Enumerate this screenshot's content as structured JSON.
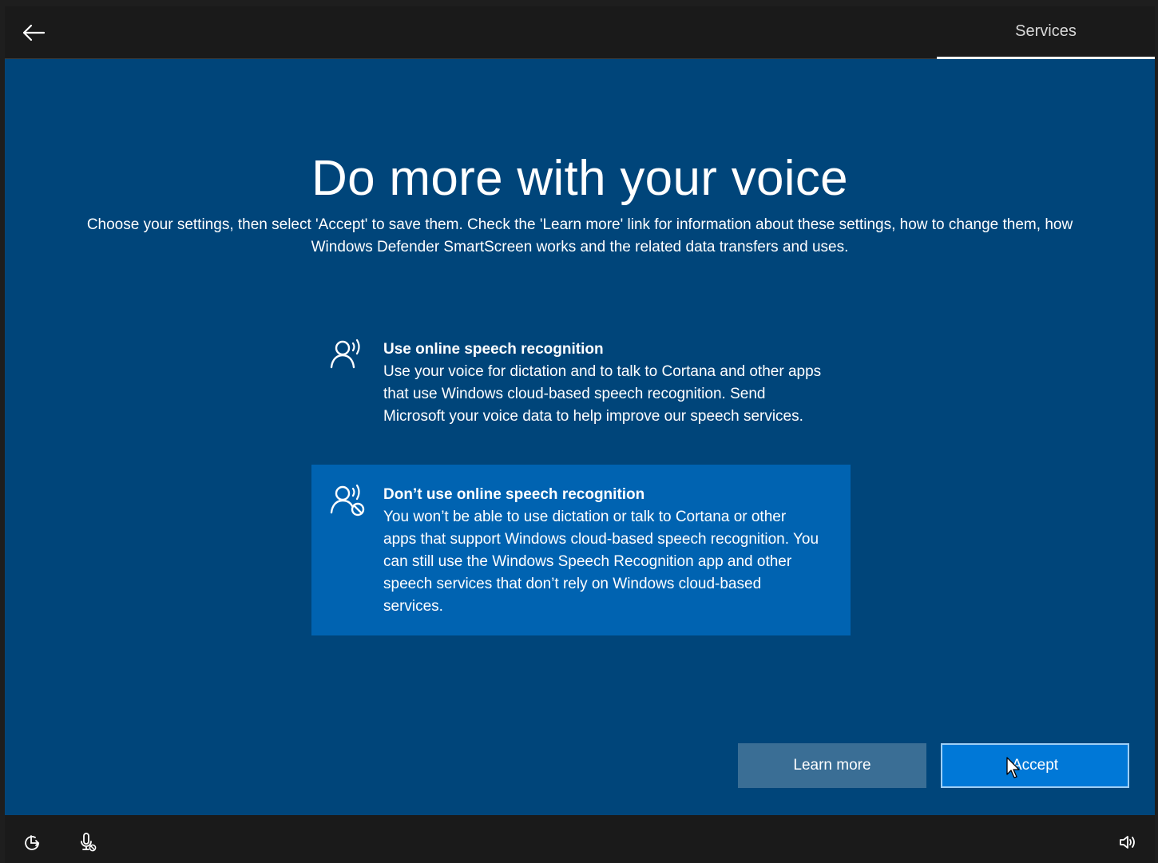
{
  "header": {
    "tab_label": "Services"
  },
  "main": {
    "title": "Do more with your voice",
    "subtitle": "Choose your settings, then select 'Accept' to save them. Check the 'Learn more' link for information about these settings, how to change them, how Windows Defender SmartScreen works and the related data transfers and uses."
  },
  "options": [
    {
      "title": "Use online speech recognition",
      "description": "Use your voice for dictation and to talk to Cortana and other apps that use Windows cloud-based speech recognition. Send Microsoft your voice data to help improve our speech services.",
      "icon": "speech-recognition-icon",
      "selected": false
    },
    {
      "title": "Don’t use online speech recognition",
      "description": "You won’t be able to use dictation or talk to Cortana or other apps that support Windows cloud-based speech recognition. You can still use the Windows Speech Recognition app and other speech services that don’t rely on Windows cloud-based services.",
      "icon": "speech-recognition-off-icon",
      "selected": true
    }
  ],
  "buttons": {
    "learn_more": "Learn more",
    "accept": "Accept"
  },
  "footer": {
    "icons": [
      "ease-of-access-icon",
      "microphone-icon",
      "volume-icon"
    ]
  },
  "colors": {
    "background": "#00457a",
    "selected_option": "#0063b1",
    "accent": "#0078d7",
    "secondary_button": "#3a6e95",
    "bars": "#1a1a1a"
  }
}
